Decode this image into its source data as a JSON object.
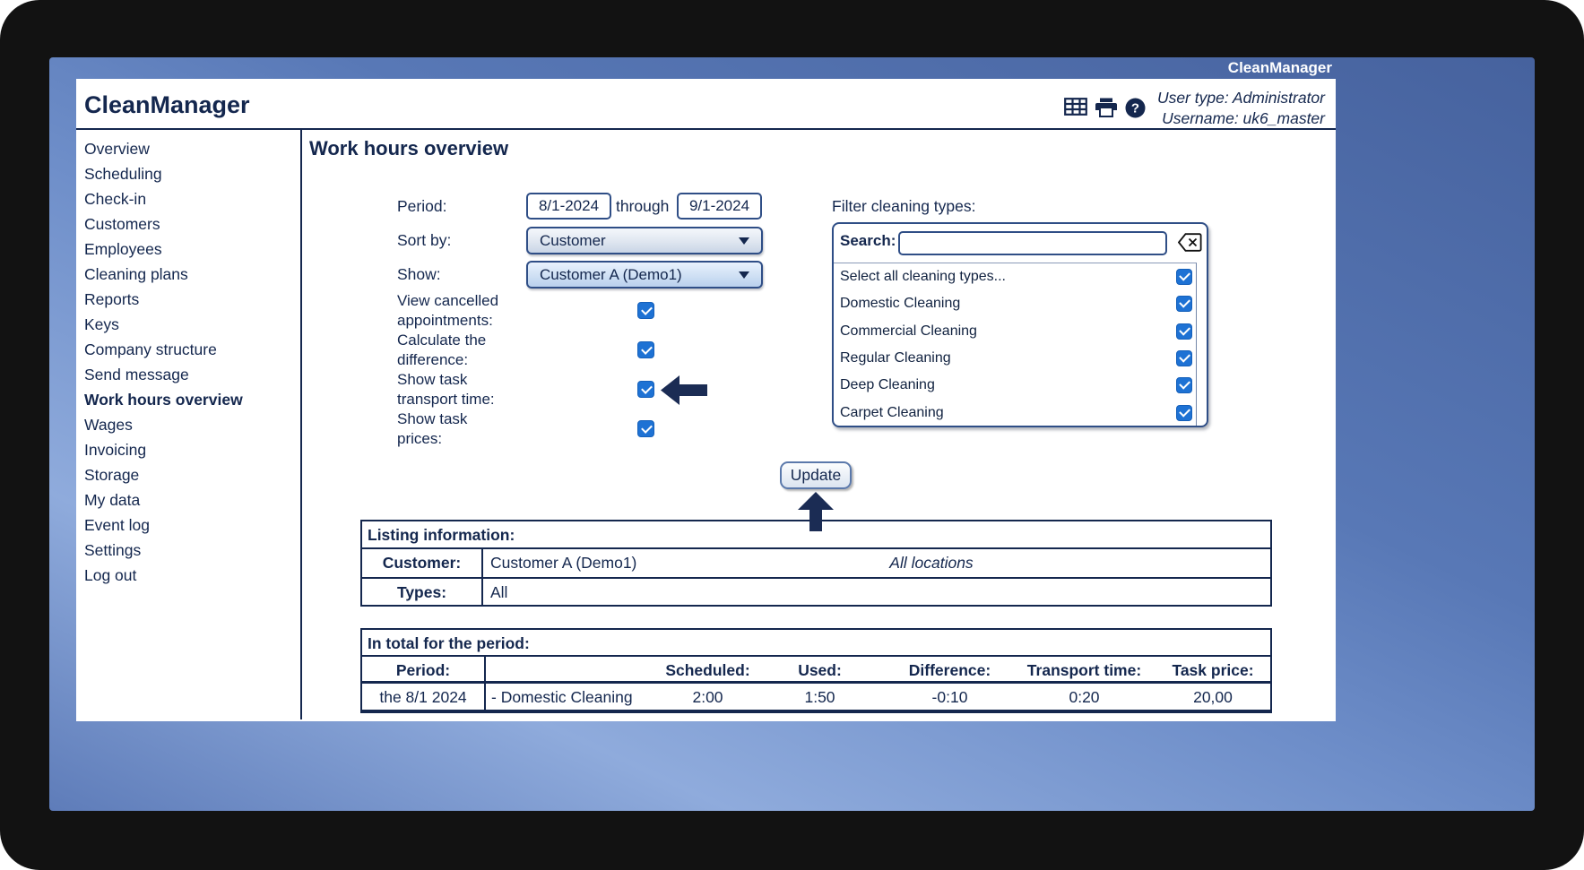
{
  "window": {
    "brand": "CleanManager"
  },
  "header": {
    "title": "CleanManager",
    "user_type": "User type: Administrator",
    "username": "Username: uk6_master"
  },
  "icons": {
    "table": "grid-3x3",
    "print": "printer",
    "help": "question-circle",
    "clear_search": "backspace",
    "dropdown": "caret-down",
    "checkbox_check": "check",
    "pointer_left": "arrow-left",
    "pointer_up": "arrow-up"
  },
  "colors": {
    "text_navy": "#14274e",
    "checkbox_blue": "#1e72d4",
    "screen_blue_dark": "#46629e",
    "screen_blue_light": "#8fabdc",
    "frame_black": "#121212"
  },
  "sidebar": {
    "items": [
      {
        "label": "Overview",
        "active": false
      },
      {
        "label": "Scheduling",
        "active": false
      },
      {
        "label": "Check-in",
        "active": false
      },
      {
        "label": "Customers",
        "active": false
      },
      {
        "label": "Employees",
        "active": false
      },
      {
        "label": "Cleaning plans",
        "active": false
      },
      {
        "label": "Reports",
        "active": false
      },
      {
        "label": "Keys",
        "active": false
      },
      {
        "label": "Company structure",
        "active": false
      },
      {
        "label": "Send message",
        "active": false
      },
      {
        "label": "Work hours overview",
        "active": true
      },
      {
        "label": "Wages",
        "active": false
      },
      {
        "label": "Invoicing",
        "active": false
      },
      {
        "label": "Storage",
        "active": false
      },
      {
        "label": "My data",
        "active": false
      },
      {
        "label": "Event log",
        "active": false
      },
      {
        "label": "Settings",
        "active": false
      },
      {
        "label": "Log out",
        "active": false
      }
    ]
  },
  "main": {
    "title": "Work hours overview",
    "form": {
      "period_label": "Period:",
      "period_from": "8/1-2024",
      "through_label": "through",
      "period_to": "9/1-2024",
      "sort_by_label": "Sort by:",
      "sort_by_value": "Customer",
      "show_label": "Show:",
      "show_value": "Customer A (Demo1)",
      "checkboxes": [
        {
          "label": "View cancelled appointments:",
          "checked": true
        },
        {
          "label": "Calculate the difference:",
          "checked": true
        },
        {
          "label": "Show task transport time:",
          "checked": true
        },
        {
          "label": "Show task prices:",
          "checked": true
        }
      ]
    },
    "filter": {
      "title": "Filter cleaning types:",
      "search_label": "Search:",
      "search_value": "",
      "options": [
        {
          "label": "Select all cleaning types...",
          "checked": true
        },
        {
          "label": "Domestic Cleaning",
          "checked": true
        },
        {
          "label": "Commercial Cleaning",
          "checked": true
        },
        {
          "label": "Regular Cleaning",
          "checked": true
        },
        {
          "label": "Deep Cleaning",
          "checked": true
        },
        {
          "label": "Carpet Cleaning",
          "checked": true
        }
      ]
    },
    "update_button": "Update",
    "listing": {
      "title": "Listing information:",
      "rows": [
        {
          "label": "Customer:",
          "value": "Customer A (Demo1)",
          "note": "All locations"
        },
        {
          "label": "Types:",
          "value": "All",
          "note": ""
        }
      ]
    },
    "totals": {
      "title": "In total for the period:",
      "headers": [
        "Period:",
        "",
        "Scheduled:",
        "Used:",
        "Difference:",
        "Transport time:",
        "Task price:"
      ],
      "rows": [
        [
          "the 8/1 2024",
          "- Domestic Cleaning",
          "2:00",
          "1:50",
          "-0:10",
          "0:20",
          "20,00"
        ]
      ]
    }
  }
}
